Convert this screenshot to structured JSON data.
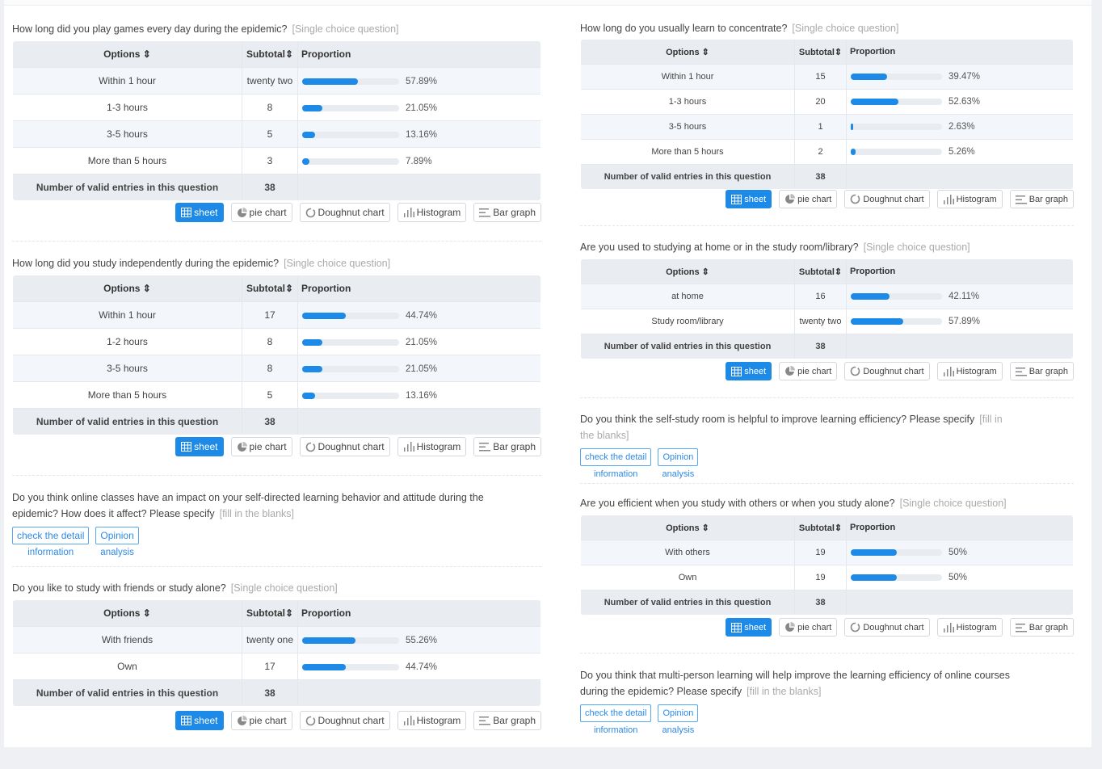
{
  "table_headers": {
    "options": "Options ⇕",
    "subtotal": "Subtotal⇕",
    "proportion": "Proportion"
  },
  "valid_entries_label": "Number of valid entries in this question",
  "type_single": "[Single choice question]",
  "type_blank": "[fill in the blanks]",
  "chart_buttons": {
    "sheet": "sheet",
    "pie": "pie chart",
    "doughnut": "Doughnut chart",
    "histogram": "Histogram",
    "bar": "Bar graph"
  },
  "blank_buttons": {
    "detail_top": "check the detail",
    "detail_bottom": "information",
    "opinion_top": "Opinion",
    "opinion_bottom": "analysis"
  },
  "accent_color": "#1e8ae8",
  "left": {
    "q1": {
      "title": "How long did you play games every day during the epidemic?",
      "rows": [
        {
          "option": "Within 1 hour",
          "subtotal": "twenty two",
          "percent": "57.89%",
          "fraction": 0.5789
        },
        {
          "option": "1-3 hours",
          "subtotal": "8",
          "percent": "21.05%",
          "fraction": 0.2105
        },
        {
          "option": "3-5 hours",
          "subtotal": "5",
          "percent": "13.16%",
          "fraction": 0.1316
        },
        {
          "option": "More than 5 hours",
          "subtotal": "3",
          "percent": "7.89%",
          "fraction": 0.0789
        }
      ],
      "total": "38"
    },
    "q2": {
      "title": "How long did you study independently during the epidemic?",
      "rows": [
        {
          "option": "Within 1 hour",
          "subtotal": "17",
          "percent": "44.74%",
          "fraction": 0.4474
        },
        {
          "option": "1-2 hours",
          "subtotal": "8",
          "percent": "21.05%",
          "fraction": 0.2105
        },
        {
          "option": "3-5 hours",
          "subtotal": "8",
          "percent": "21.05%",
          "fraction": 0.2105
        },
        {
          "option": "More than 5 hours",
          "subtotal": "5",
          "percent": "13.16%",
          "fraction": 0.1316
        }
      ],
      "total": "38"
    },
    "q3": {
      "title": "Do you think online classes have an impact on your self-directed learning behavior and attitude during the epidemic? How does it affect? Please specify"
    },
    "q4": {
      "title": "Do you like to study with friends or study alone?",
      "rows": [
        {
          "option": "With friends",
          "subtotal": "twenty one",
          "percent": "55.26%",
          "fraction": 0.5526
        },
        {
          "option": "Own",
          "subtotal": "17",
          "percent": "44.74%",
          "fraction": 0.4474
        }
      ],
      "total": "38"
    }
  },
  "right": {
    "q1": {
      "title": "How long do you usually learn to concentrate?",
      "rows": [
        {
          "option": "Within 1 hour",
          "subtotal": "15",
          "percent": "39.47%",
          "fraction": 0.3947
        },
        {
          "option": "1-3 hours",
          "subtotal": "20",
          "percent": "52.63%",
          "fraction": 0.5263
        },
        {
          "option": "3-5 hours",
          "subtotal": "1",
          "percent": "2.63%",
          "fraction": 0.0263
        },
        {
          "option": "More than 5 hours",
          "subtotal": "2",
          "percent": "5.26%",
          "fraction": 0.0526
        }
      ],
      "total": "38"
    },
    "q2": {
      "title": "Are you used to studying at home or in the study room/library?",
      "rows": [
        {
          "option": "at home",
          "subtotal": "16",
          "percent": "42.11%",
          "fraction": 0.4211
        },
        {
          "option": "Study room/library",
          "subtotal": "twenty two",
          "percent": "57.89%",
          "fraction": 0.5789
        }
      ],
      "total": "38"
    },
    "q3": {
      "title": "Do you think the self-study room is helpful to improve learning efficiency? Please specify"
    },
    "q4": {
      "title": "Are you efficient when you study with others or when you study alone?",
      "rows": [
        {
          "option": "With others",
          "subtotal": "19",
          "percent": "50%",
          "fraction": 0.5
        },
        {
          "option": "Own",
          "subtotal": "19",
          "percent": "50%",
          "fraction": 0.5
        }
      ],
      "total": "38"
    },
    "q5": {
      "title": "Do you think that multi-person learning will help improve the learning efficiency of online courses during the epidemic? Please specify"
    }
  }
}
